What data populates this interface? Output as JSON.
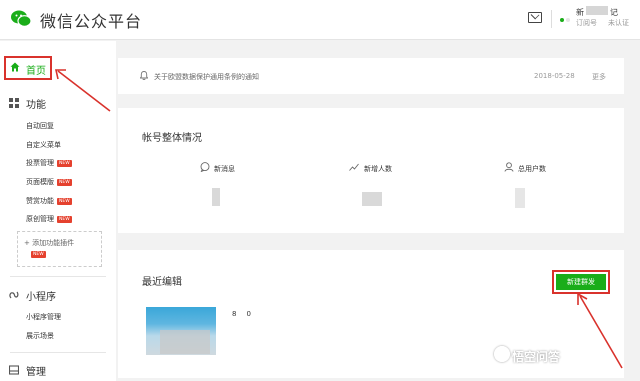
{
  "header": {
    "brand": "微信公众平台",
    "account_name_first": "新",
    "account_name_last": "记",
    "account_type": "订阅号",
    "verification": "未认证"
  },
  "sidebar": {
    "home_label": "首页",
    "features": {
      "label": "功能",
      "items": [
        {
          "label": "自动回复",
          "new": ""
        },
        {
          "label": "自定义菜单",
          "new": ""
        },
        {
          "label": "投票管理",
          "new": "NEW"
        },
        {
          "label": "页面模版",
          "new": "NEW"
        },
        {
          "label": "赞赏功能",
          "new": "NEW"
        },
        {
          "label": "原创管理",
          "new": "NEW"
        }
      ],
      "add_plugin": "添加功能插件",
      "add_plugin_badge": "NEW"
    },
    "miniprogram": {
      "label": "小程序",
      "items": [
        {
          "label": "小程序管理"
        },
        {
          "label": "展示场景"
        }
      ]
    },
    "manage": {
      "label": "管理"
    }
  },
  "notice": {
    "text": "关于欧盟数据保护通用条例的通知",
    "date": "2018-05-28",
    "more": "更多"
  },
  "overview": {
    "title": "帐号整体情况",
    "stats": [
      {
        "label": "新消息",
        "icon": "chat-bubble-icon"
      },
      {
        "label": "新增人数",
        "icon": "trend-up-icon"
      },
      {
        "label": "总用户数",
        "icon": "user-icon"
      }
    ]
  },
  "recent": {
    "title": "最近编辑",
    "new_button": "新建群发",
    "item_title_first": "8",
    "item_title_last": "0"
  },
  "watermark": "悟空问答",
  "colors": {
    "accent_green": "#1aad19",
    "annotation_red": "#d9322c"
  }
}
